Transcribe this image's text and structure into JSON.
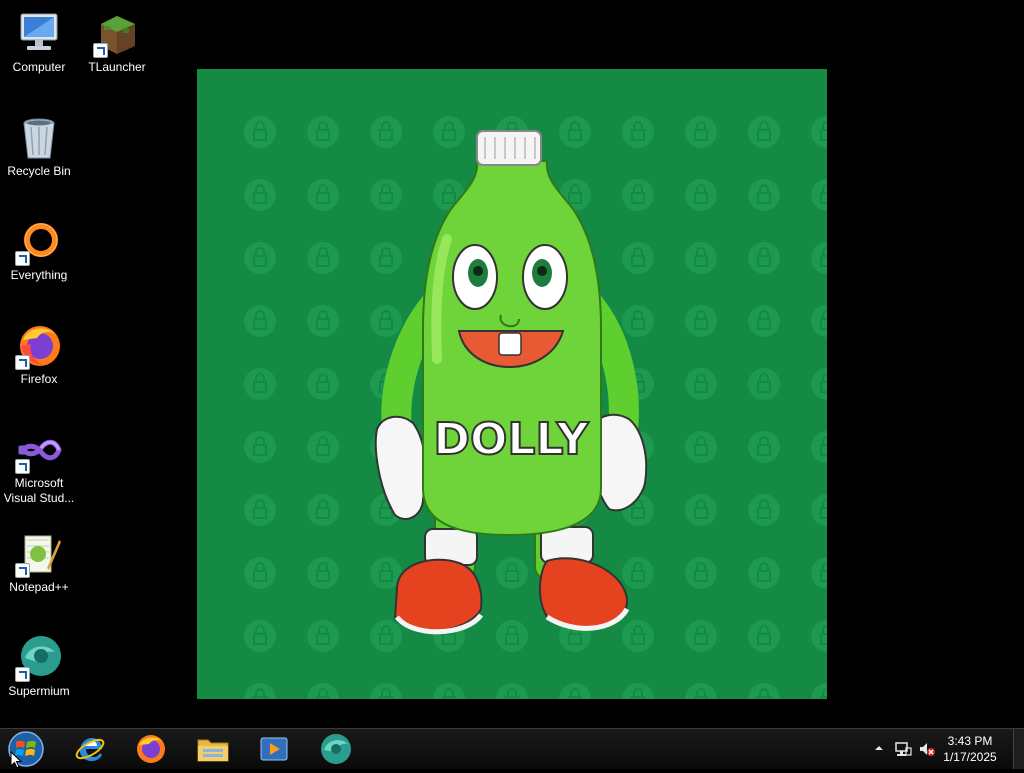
{
  "desktop": {
    "icons": [
      {
        "label": "Computer",
        "icon": "computer-icon"
      },
      {
        "label": "TLauncher",
        "icon": "tlauncher-icon"
      },
      {
        "label": "Recycle Bin",
        "icon": "recycle-bin-icon"
      },
      {
        "label": "Everything",
        "icon": "everything-icon"
      },
      {
        "label": "Firefox",
        "icon": "firefox-icon"
      },
      {
        "label": "Microsoft\nVisual Stud...",
        "icon": "visual-studio-icon"
      },
      {
        "label": "Notepad++",
        "icon": "notepad-plus-plus-icon"
      },
      {
        "label": "Supermium",
        "icon": "supermium-icon"
      }
    ],
    "wallpaper": {
      "shirt_text": "DOLLY",
      "background_color": "#148a45",
      "pattern_color": "#1d9a50",
      "bottle_color": "#6fd33a"
    }
  },
  "taskbar": {
    "start_icon": "windows-start-orb-icon",
    "pinned": [
      {
        "name": "internet-explorer",
        "icon": "internet-explorer-icon"
      },
      {
        "name": "firefox",
        "icon": "firefox-icon"
      },
      {
        "name": "file-explorer",
        "icon": "folder-icon"
      },
      {
        "name": "media-player",
        "icon": "media-player-icon"
      },
      {
        "name": "supermium",
        "icon": "supermium-icon"
      }
    ],
    "tray": {
      "expand_icon": "tray-expand-icon",
      "network_icon": "network-icon",
      "volume_icon": "volume-muted-icon",
      "time": "3:43 PM",
      "date": "1/17/2025"
    }
  }
}
